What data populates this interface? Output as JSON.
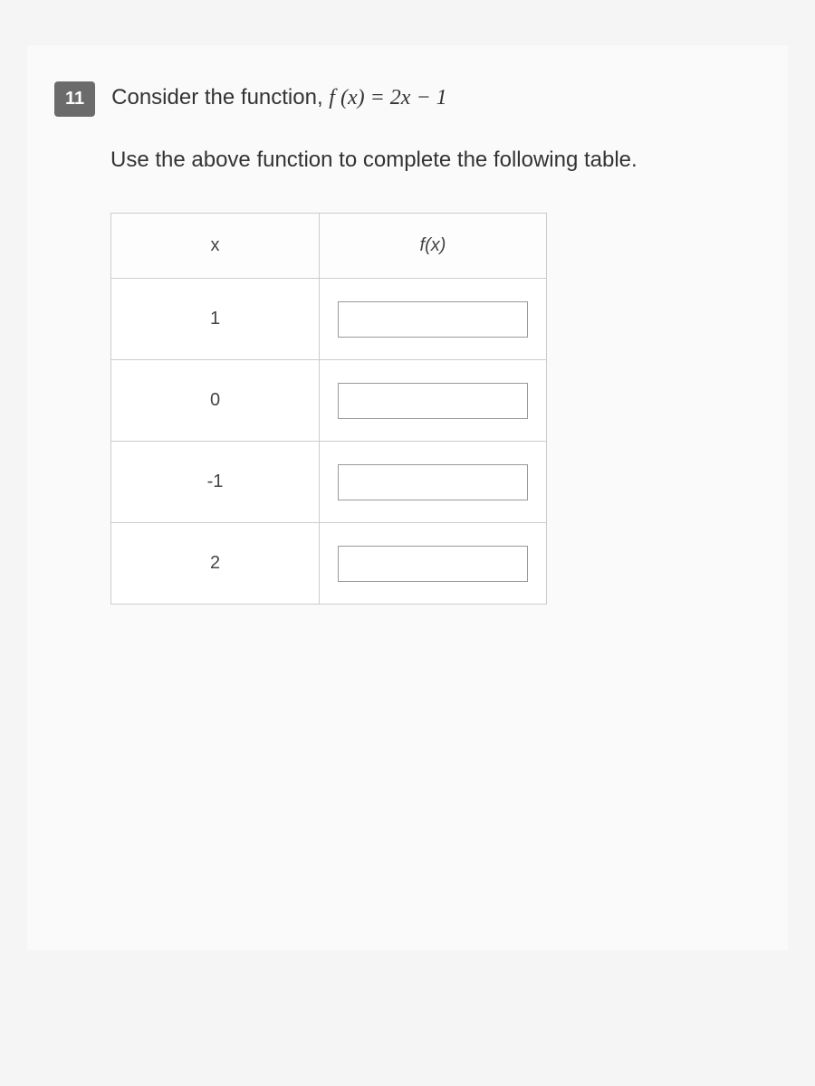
{
  "question": {
    "number": "11",
    "prompt_prefix": "Consider the function, ",
    "function_expr": "f (x) = 2x − 1",
    "instruction": "Use the above function to complete the following table."
  },
  "table": {
    "headers": {
      "x": "x",
      "fx": "f(x)"
    },
    "rows": [
      {
        "x": "1",
        "fx": ""
      },
      {
        "x": "0",
        "fx": ""
      },
      {
        "x": "-1",
        "fx": ""
      },
      {
        "x": "2",
        "fx": ""
      }
    ]
  }
}
